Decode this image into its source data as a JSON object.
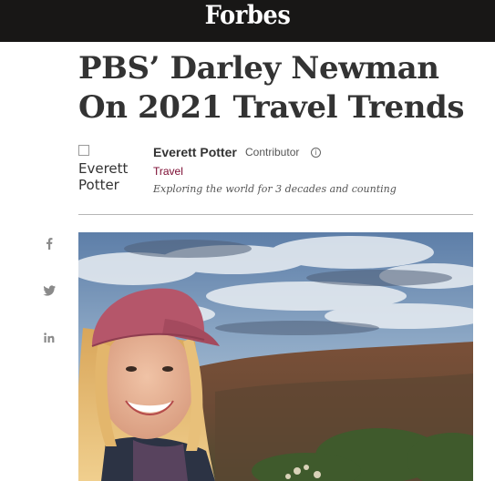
{
  "header": {
    "logo": "Forbes",
    "background": "#181716"
  },
  "article": {
    "title": "PBS’ Darley Newman On 2021 Travel Trends",
    "author": {
      "avatar_alt": "Everett Potter",
      "name": "Everett Potter",
      "role": "Contributor",
      "channel": "Travel",
      "bio": "Exploring the world for 3 decades and counting"
    },
    "hero_image": {
      "alt": ""
    }
  },
  "share": {
    "icons": [
      "facebook-icon",
      "twitter-icon",
      "linkedin-icon"
    ]
  },
  "colors": {
    "accent": "#7b0a30",
    "text": "#333333"
  }
}
